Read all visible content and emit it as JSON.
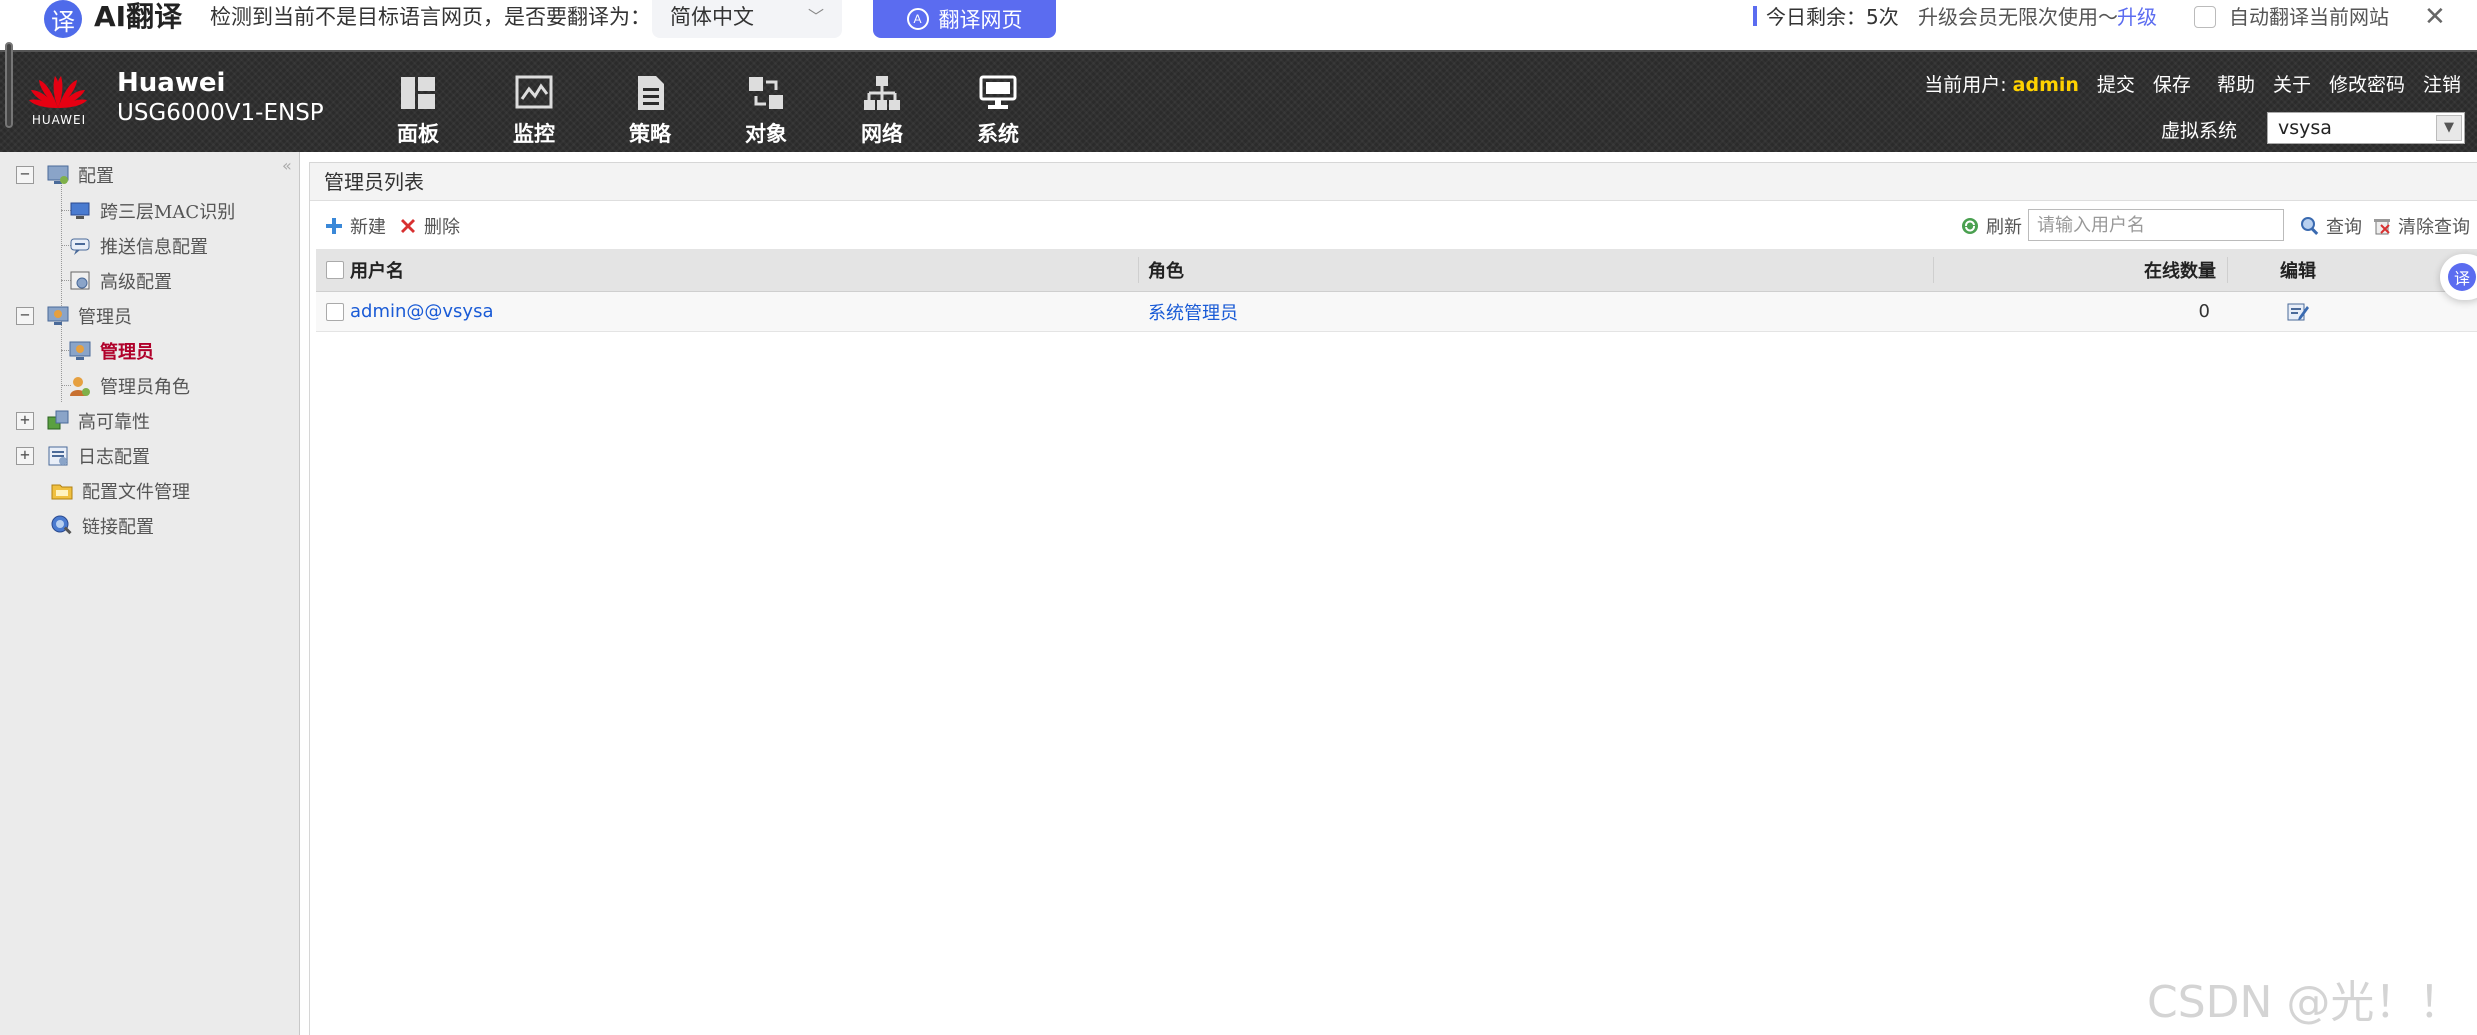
{
  "translate_bar": {
    "badge": "译",
    "title": "AI翻译",
    "prompt": "检测到当前不是目标语言网页，是否要翻译为：",
    "target_language": "简体中文",
    "translate_button": "翻译网页",
    "remaining": "今日剩余：5次",
    "upgrade_text": "升级会员无限次使用～",
    "upgrade_link": "升级",
    "auto_translate_label": "自动翻译当前网站",
    "close": "✕"
  },
  "header": {
    "logo_text": "HUAWEI",
    "brand_name": "Huawei",
    "model": "USG6000V1-ENSP",
    "nav": [
      {
        "label": "面板",
        "icon": "dashboard-icon"
      },
      {
        "label": "监控",
        "icon": "monitor-icon"
      },
      {
        "label": "策略",
        "icon": "policy-icon"
      },
      {
        "label": "对象",
        "icon": "object-icon"
      },
      {
        "label": "网络",
        "icon": "network-icon"
      },
      {
        "label": "系统",
        "icon": "system-icon"
      }
    ],
    "current_user_label": "当前用户:",
    "current_user": "admin",
    "links": [
      "提交",
      "保存",
      "帮助",
      "关于",
      "修改密码",
      "注销"
    ],
    "vsys_label": "虚拟系统",
    "vsys_value": "vsysa"
  },
  "sidebar": {
    "collapse_glyph": "«",
    "items": [
      {
        "label": "配置",
        "toggle": "−"
      },
      {
        "label": "跨三层MAC识别"
      },
      {
        "label": "推送信息配置"
      },
      {
        "label": "高级配置"
      },
      {
        "label": "管理员",
        "toggle": "−"
      },
      {
        "label": "管理员"
      },
      {
        "label": "管理员角色"
      },
      {
        "label": "高可靠性",
        "toggle": "+"
      },
      {
        "label": "日志配置",
        "toggle": "+"
      },
      {
        "label": "配置文件管理"
      },
      {
        "label": "链接配置"
      }
    ]
  },
  "main": {
    "panel_title": "管理员列表",
    "toolbar": {
      "new": "新建",
      "delete": "删除",
      "refresh": "刷新",
      "search_placeholder": "请输入用户名",
      "query": "查询",
      "clear_query": "清除查询"
    },
    "table": {
      "columns": [
        "用户名",
        "角色",
        "在线数量",
        "编辑"
      ],
      "rows": [
        {
          "username": "admin@@vsysa",
          "role": "系统管理员",
          "online": "0"
        }
      ]
    }
  },
  "floating_badge": "译",
  "watermark": "CSDN @光！！",
  "colors": {
    "accent_blue": "#5b6cf0",
    "header_bg": "#2b2b2b",
    "huawei_red": "#e60012",
    "user_yellow": "#ffd200",
    "active_item": "#b0002a",
    "link_blue": "#1a5bd6"
  }
}
